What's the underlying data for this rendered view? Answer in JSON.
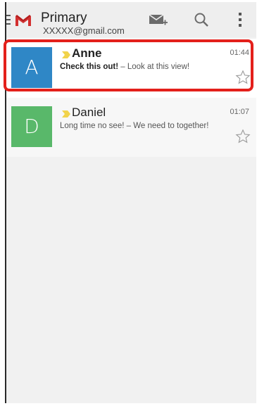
{
  "header": {
    "title": "Primary",
    "account": "XXXXX@gmail.com",
    "actions": {
      "compose": "compose-icon",
      "search": "search-icon",
      "menu": "overflow-menu-icon"
    }
  },
  "colors": {
    "brand": "#d32f2f",
    "highlight": "#e3201b",
    "avatar_anne": "#2f87c6",
    "avatar_daniel": "#59b86a",
    "important_marker": "#f1d34b"
  },
  "messages": [
    {
      "initial": "A",
      "sender": "Anne",
      "time": "01:44",
      "subject": "Check this out!",
      "separator": " – ",
      "preview": "Look at this view!",
      "unread": true
    },
    {
      "initial": "D",
      "sender": "Daniel",
      "time": "01:07",
      "subject": "Long time no see!",
      "separator": " – ",
      "preview": "We need to together!",
      "unread": false
    }
  ]
}
